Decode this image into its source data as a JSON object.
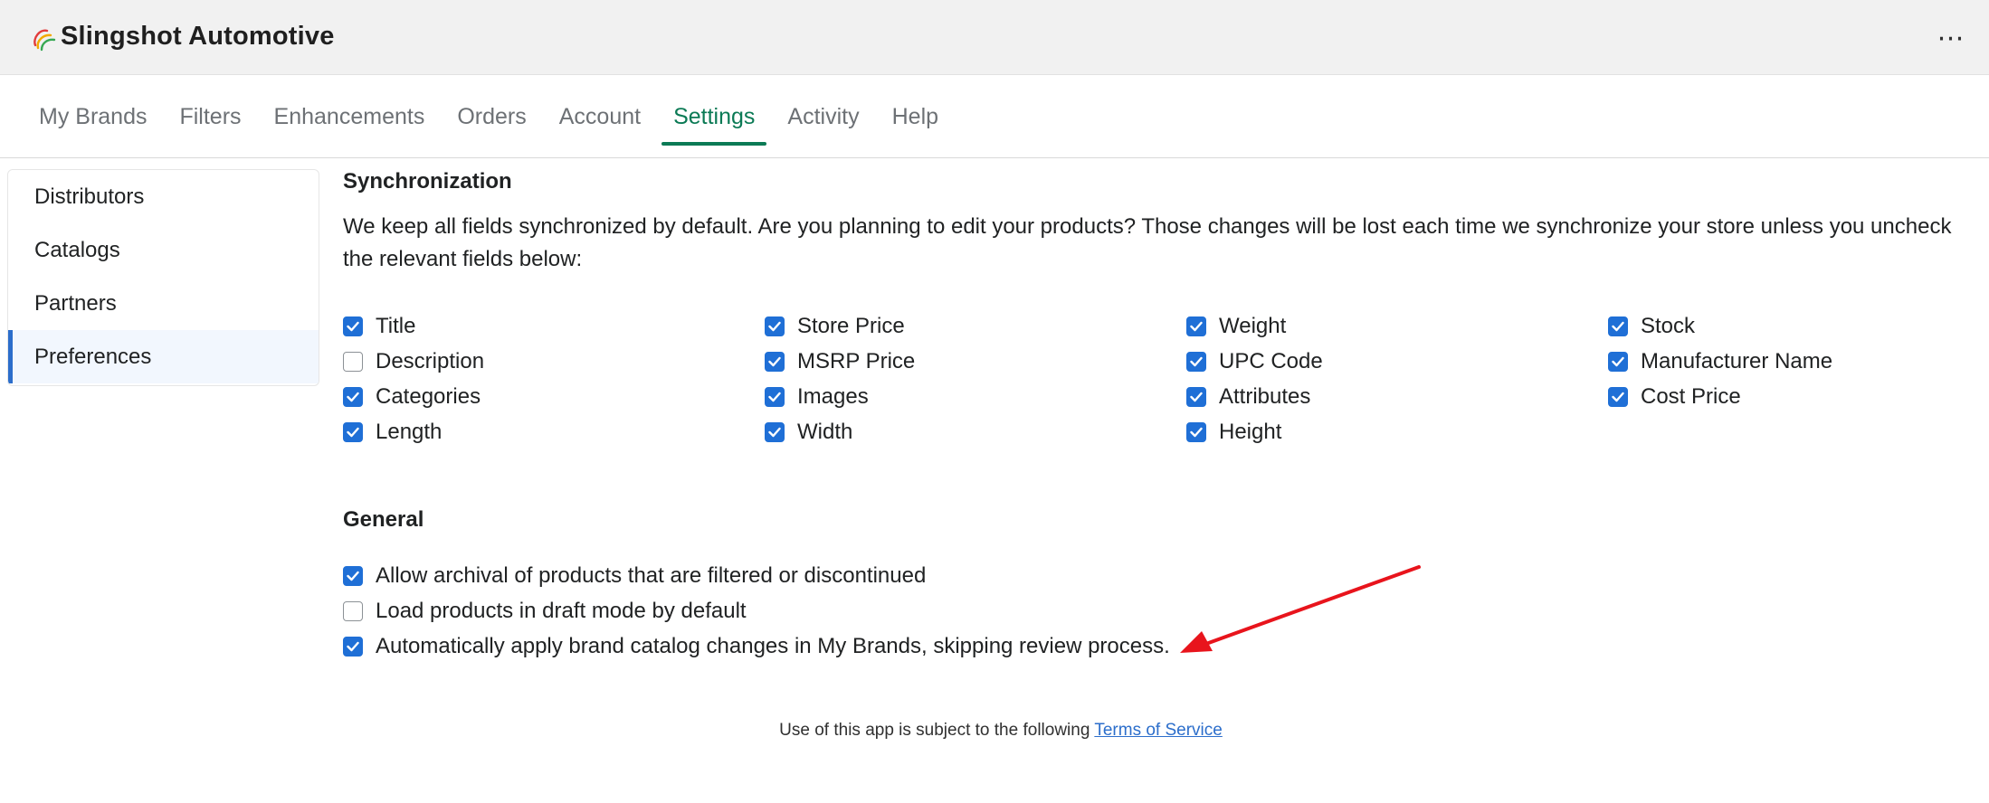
{
  "app": {
    "title": "Slingshot Automotive",
    "logo_icon": "slingshot-logo-icon",
    "more_label": "⋯"
  },
  "tabs": [
    {
      "label": "My Brands",
      "active": false
    },
    {
      "label": "Filters",
      "active": false
    },
    {
      "label": "Enhancements",
      "active": false
    },
    {
      "label": "Orders",
      "active": false
    },
    {
      "label": "Account",
      "active": false
    },
    {
      "label": "Settings",
      "active": true
    },
    {
      "label": "Activity",
      "active": false
    },
    {
      "label": "Help",
      "active": false
    }
  ],
  "sidenav": {
    "items": [
      {
        "label": "Distributors",
        "active": false
      },
      {
        "label": "Catalogs",
        "active": false
      },
      {
        "label": "Partners",
        "active": false
      },
      {
        "label": "Preferences",
        "active": true
      }
    ]
  },
  "sync": {
    "title": "Synchronization",
    "description": "We keep all fields synchronized by default. Are you planning to edit your products? Those changes will be lost each time we synchronize your store unless you uncheck the relevant fields below:",
    "fields": [
      {
        "label": "Title",
        "checked": true
      },
      {
        "label": "Store Price",
        "checked": true
      },
      {
        "label": "Weight",
        "checked": true
      },
      {
        "label": "Stock",
        "checked": true
      },
      {
        "label": "Description",
        "checked": false
      },
      {
        "label": "MSRP Price",
        "checked": true
      },
      {
        "label": "UPC Code",
        "checked": true
      },
      {
        "label": "Manufacturer Name",
        "checked": true
      },
      {
        "label": "Categories",
        "checked": true
      },
      {
        "label": "Images",
        "checked": true
      },
      {
        "label": "Attributes",
        "checked": true
      },
      {
        "label": "Cost Price",
        "checked": true
      },
      {
        "label": "Length",
        "checked": true
      },
      {
        "label": "Width",
        "checked": true
      },
      {
        "label": "Height",
        "checked": true
      }
    ]
  },
  "general": {
    "title": "General",
    "options": [
      {
        "label": "Allow archival of products that are filtered or discontinued",
        "checked": true
      },
      {
        "label": "Load products in draft mode by default",
        "checked": false
      },
      {
        "label": "Automatically apply brand catalog changes in My Brands, skipping review process.",
        "checked": true
      }
    ]
  },
  "footer": {
    "text": "Use of this app is subject to the following",
    "link": "Terms of Service"
  },
  "colors": {
    "accent_green": "#0b7a55",
    "checkbox_blue": "#1f6fd6",
    "annotation_red": "#e8141c"
  }
}
